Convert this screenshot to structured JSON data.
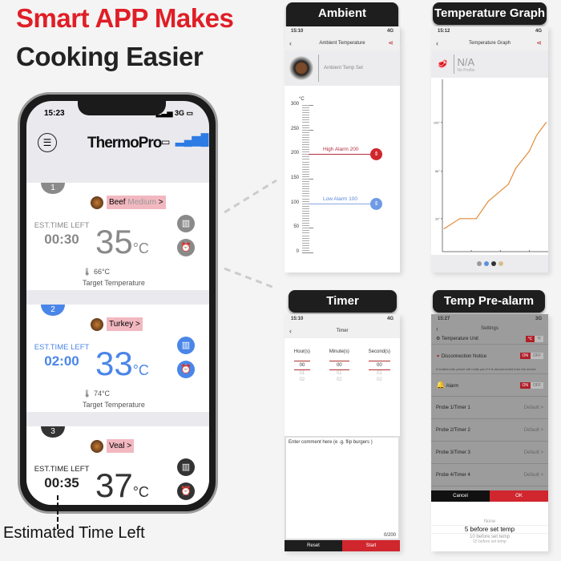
{
  "headline": {
    "line1": "Smart APP Makes",
    "line2": "Cooking Easier",
    "accent": "#e01e26"
  },
  "main_phone": {
    "time": "15:23",
    "network": "3G",
    "logo": "ThermoPro",
    "probes": [
      {
        "number": "1",
        "food": "Beef",
        "doneness": "Medium",
        "arrow": ">",
        "est_label": "EST.TIME LEFT",
        "est_time": "00:30",
        "temp": "35",
        "unit": "°C",
        "target": "66°C",
        "target_label": "Target Temperature",
        "color": "#8a8a8a"
      },
      {
        "number": "2",
        "food": "Turkey",
        "doneness": "",
        "arrow": ">",
        "est_label": "EST.TIME LEFT",
        "est_time": "02:00",
        "temp": "33",
        "unit": "°C",
        "target": "74°C",
        "target_label": "Target Temperature",
        "color": "#4a86e8"
      },
      {
        "number": "3",
        "food": "Veal",
        "doneness": "",
        "arrow": ">",
        "est_label": "EST.TIME LEFT",
        "est_time": "00:35",
        "temp": "37",
        "unit": "°C",
        "color": "#333333"
      }
    ],
    "callout": "Estimated Time Left"
  },
  "ambient": {
    "pill": "Ambient Temperature",
    "time": "15:10",
    "network": "4G",
    "title": "Ambient Temperature",
    "set_label": "Ambient Temp Set",
    "unit": "°C",
    "scale": [
      "300",
      "250",
      "200",
      "150",
      "100",
      "50",
      "0"
    ],
    "high_alarm": "High Alarm 200",
    "low_alarm": "Low Alarm 100"
  },
  "graph": {
    "pill": "Temperature Graph",
    "time": "15:12",
    "network": "4G",
    "title": "Temperature Graph",
    "profile_value": "N/A",
    "profile_label": "No Profile",
    "chart_data": {
      "type": "line",
      "y_ticks": [
        "100°",
        "66°",
        "33°"
      ],
      "ylim": [
        10,
        130
      ],
      "x_ticks": [
        1,
        2,
        3
      ],
      "xlim": [
        0,
        3.65
      ],
      "line_color": "#e08a3a",
      "x": [
        0.06,
        0.6,
        1.17,
        1.58,
        2.28,
        2.53,
        3.0,
        3.25,
        3.58
      ],
      "y": [
        26,
        33,
        33,
        45,
        57,
        68,
        80,
        91,
        100
      ]
    },
    "page_dots": [
      "#999999",
      "#5b8fe0",
      "#333333",
      "#d6bf8e"
    ]
  },
  "timer": {
    "pill": "Timer",
    "time": "15:10",
    "network": "4G",
    "title": "Timer",
    "columns": [
      {
        "label": "Hour(s)",
        "values": [
          "00",
          "01",
          "02"
        ]
      },
      {
        "label": "Minute(s)",
        "values": [
          "00",
          "01",
          "02"
        ]
      },
      {
        "label": "Second(s)",
        "values": [
          "00",
          "01",
          "02"
        ]
      }
    ],
    "comment_placeholder": "Enter comment here (e .g. flip burgers )",
    "counter": "0/200",
    "reset": "Reset",
    "start": "Start"
  },
  "prealarm": {
    "pill": "Temp Pre-alarm",
    "time": "15:27",
    "network": "3G",
    "title": "Settings",
    "rows": [
      {
        "label": "Temperature Unit"
      },
      {
        "label": "Disconnection Notice",
        "on": "ON",
        "off": "OFF"
      }
    ],
    "notice": "If enabled,the phone will notify you if it is disconnected from the device",
    "alarm": {
      "label": "Alarm",
      "on": "ON",
      "off": "OFF"
    },
    "probes": [
      {
        "label": "Probe 1/Timer 1",
        "value": "Default >"
      },
      {
        "label": "Probe 2/Timer 2",
        "value": "Default >"
      },
      {
        "label": "Probe 3/Timer 3",
        "value": "Default >"
      },
      {
        "label": "Probe 4/Timer 4",
        "value": "Default >"
      }
    ],
    "cancel": "Cancel",
    "ok": "OK",
    "options": [
      "None",
      "5 before set temp",
      "10 before set temp",
      "15 before set temp"
    ]
  }
}
